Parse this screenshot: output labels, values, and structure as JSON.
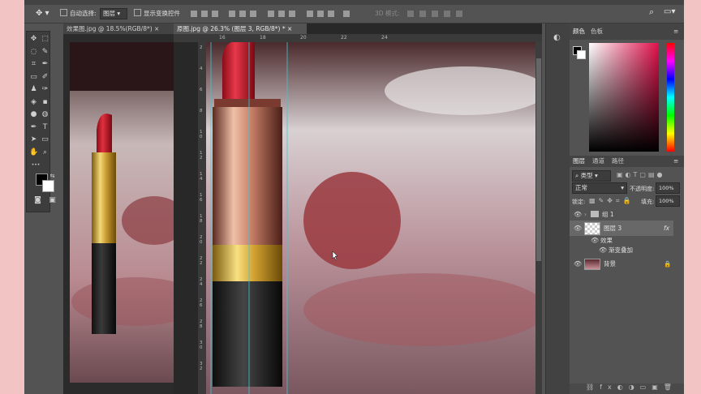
{
  "options_bar": {
    "auto_select_label": "自动选择:",
    "auto_select_value": "图层",
    "show_transform_label": "显示变换控件",
    "mode_3d_label": "3D 模式:"
  },
  "tools": [
    {
      "name": "move-tool",
      "glyph": "✥"
    },
    {
      "name": "marquee-tool",
      "glyph": "⬚"
    },
    {
      "name": "lasso-tool",
      "glyph": "◌"
    },
    {
      "name": "quick-select-tool",
      "glyph": "✎"
    },
    {
      "name": "crop-tool",
      "glyph": "⌗"
    },
    {
      "name": "eyedropper-tool",
      "glyph": "✒"
    },
    {
      "name": "frame-tool",
      "glyph": "▭"
    },
    {
      "name": "brush-tool",
      "glyph": "✐"
    },
    {
      "name": "stamp-tool",
      "glyph": "♟"
    },
    {
      "name": "history-brush-tool",
      "glyph": "✑"
    },
    {
      "name": "eraser-tool",
      "glyph": "◈"
    },
    {
      "name": "gradient-tool",
      "glyph": "▪"
    },
    {
      "name": "blur-tool",
      "glyph": "●"
    },
    {
      "name": "dodge-tool",
      "glyph": "◍"
    },
    {
      "name": "pen-tool",
      "glyph": "✒"
    },
    {
      "name": "type-tool",
      "glyph": "T"
    },
    {
      "name": "path-select-tool",
      "glyph": "➤"
    },
    {
      "name": "shape-tool",
      "glyph": "▭"
    },
    {
      "name": "hand-tool",
      "glyph": "✋"
    },
    {
      "name": "zoom-tool",
      "glyph": "⌕"
    },
    {
      "name": "more-tools",
      "glyph": "•••"
    }
  ],
  "documents": [
    {
      "tab_label": "效果图.jpg @ 18.5%(RGB/8*)",
      "close": "×"
    },
    {
      "tab_label": "原图.jpg @ 26.3% (图层 3, RGB/8*) *",
      "close": "×"
    }
  ],
  "ruler_ticks_top": [
    "16",
    "18",
    "20",
    "22",
    "24"
  ],
  "ruler_ticks_left": [
    "2",
    "4",
    "6",
    "8",
    "1\n0",
    "1\n2",
    "1\n4",
    "1\n6",
    "1\n8",
    "2\n0",
    "2\n2",
    "2\n4",
    "2\n6",
    "2\n8",
    "3\n0",
    "3\n2"
  ],
  "color_panel": {
    "tab_color": "颜色",
    "tab_swatches": "色板"
  },
  "layers_panel": {
    "tab_layers": "图层",
    "tab_channels": "通道",
    "tab_paths": "路径",
    "filter_kind": "类型",
    "blend_mode": "正常",
    "opacity_label": "不透明度:",
    "opacity_value": "100%",
    "lock_label": "锁定:",
    "fill_label": "填充:",
    "fill_value": "100%",
    "layers": [
      {
        "name": "组 1",
        "type": "group"
      },
      {
        "name": "图层 3",
        "type": "layer",
        "fx": "fx"
      },
      {
        "name": "效果",
        "type": "effects"
      },
      {
        "name": "渐变叠加",
        "type": "effect"
      },
      {
        "name": "背景",
        "type": "background"
      }
    ]
  },
  "colors": {
    "accent": "#cc2233",
    "foreground": "#000000",
    "background": "#ffffff"
  }
}
